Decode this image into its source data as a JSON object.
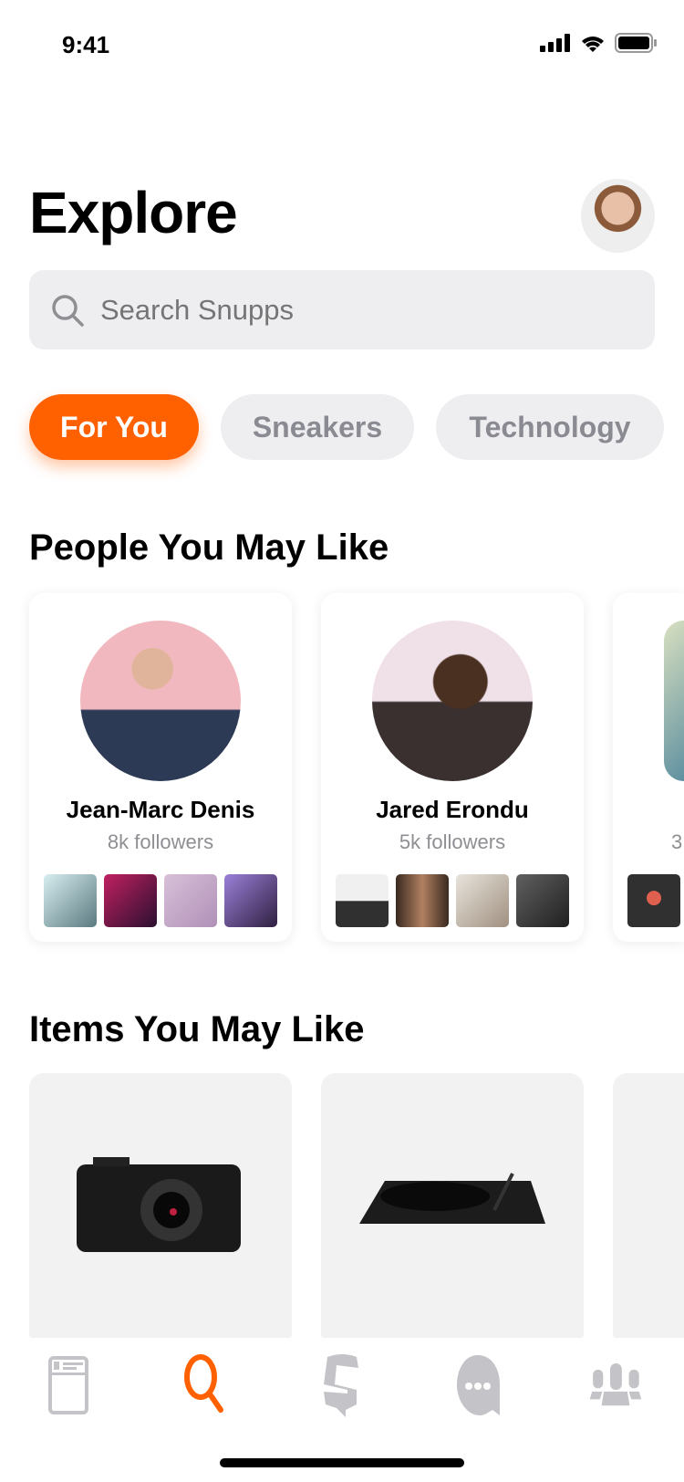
{
  "status_bar": {
    "time": "9:41"
  },
  "header": {
    "title": "Explore"
  },
  "search": {
    "placeholder": "Search Snupps"
  },
  "chips": [
    {
      "label": "For You",
      "active": true
    },
    {
      "label": "Sneakers",
      "active": false
    },
    {
      "label": "Technology",
      "active": false
    }
  ],
  "people": {
    "title": "People You May Like",
    "cards": [
      {
        "name": "Jean-Marc Denis",
        "followers": "8k followers"
      },
      {
        "name": "Jared Erondu",
        "followers": "5k followers"
      },
      {
        "name": "",
        "followers": "3"
      }
    ]
  },
  "items": {
    "title": "Items You May Like"
  },
  "tabbar": {
    "items": [
      "feed-icon",
      "search-icon",
      "snupps-icon",
      "chat-icon",
      "people-icon"
    ],
    "active": "search-icon"
  },
  "colors": {
    "accent": "#ff6000",
    "inactive": "#c4c4c8"
  }
}
